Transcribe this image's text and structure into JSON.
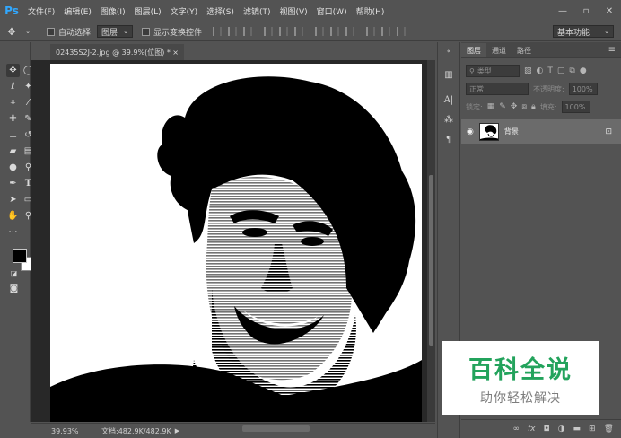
{
  "app": {
    "logo_text": "Ps"
  },
  "menu": {
    "items": [
      {
        "name": "menu-file",
        "label": "文件(F)"
      },
      {
        "name": "menu-edit",
        "label": "编辑(E)"
      },
      {
        "name": "menu-image",
        "label": "图像(I)"
      },
      {
        "name": "menu-layer",
        "label": "图层(L)"
      },
      {
        "name": "menu-type",
        "label": "文字(Y)"
      },
      {
        "name": "menu-select",
        "label": "选择(S)"
      },
      {
        "name": "menu-filter",
        "label": "滤镜(T)"
      },
      {
        "name": "menu-view",
        "label": "视图(V)"
      },
      {
        "name": "menu-window",
        "label": "窗口(W)"
      },
      {
        "name": "menu-help",
        "label": "帮助(H)"
      }
    ]
  },
  "options": {
    "auto_select_label": "自动选择:",
    "auto_select_value": "图层",
    "show_transform_label": "显示变换控件",
    "workspace_value": "基本功能"
  },
  "document": {
    "tab_label": "02435S2J-2.jpg @ 39.9%(位图) *",
    "close_glyph": "×"
  },
  "status": {
    "zoom": "39.93%",
    "doc_size": "文档:482.9K/482.9K"
  },
  "layers_panel": {
    "tabs": [
      "图层",
      "通道",
      "路径"
    ],
    "kind_placeholder": "类型",
    "blend_mode": "正常",
    "opacity_label": "不透明度:",
    "opacity_value": "100%",
    "lock_label": "锁定:",
    "fill_label": "填充:",
    "fill_value": "100%",
    "layer": {
      "name": "背景"
    }
  },
  "watermark": {
    "title": "百科全说",
    "subtitle": "助你轻松解决",
    "color": "#23a35c"
  }
}
